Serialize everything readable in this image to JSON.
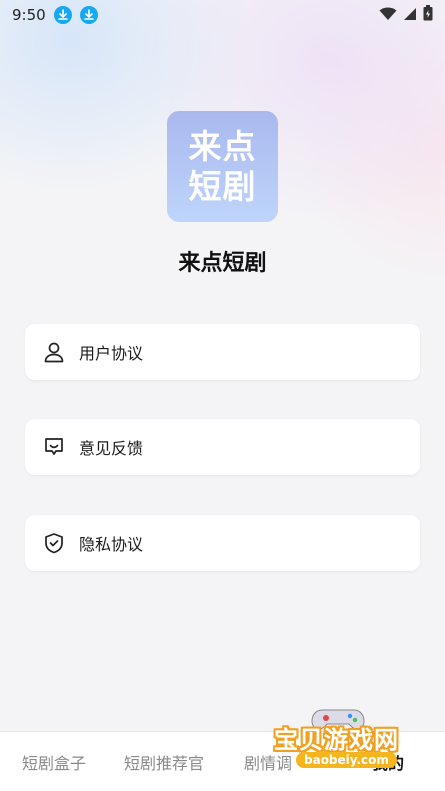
{
  "status_bar": {
    "time": "9:50"
  },
  "app": {
    "logo_line1": "来点",
    "logo_line2": "短剧",
    "name": "来点短剧"
  },
  "menu": {
    "items": [
      {
        "label": "用户协议",
        "icon": "user-icon"
      },
      {
        "label": "意见反馈",
        "icon": "feedback-icon"
      },
      {
        "label": "隐私协议",
        "icon": "shield-check-icon"
      }
    ]
  },
  "bottom_nav": {
    "items": [
      {
        "label": "短剧盒子",
        "active": false
      },
      {
        "label": "短剧推荐官",
        "active": false
      },
      {
        "label": "剧情调",
        "active": false
      },
      {
        "label": "我的",
        "active": true
      }
    ]
  },
  "watermark": {
    "text": "宝贝游戏网",
    "url": "baobeiy.com"
  },
  "colors": {
    "accent_blue": "#16a8f0",
    "logo_gradient_top": "#a9b8ee",
    "logo_gradient_bottom": "#bed5fb",
    "watermark_orange": "#f0a020"
  }
}
